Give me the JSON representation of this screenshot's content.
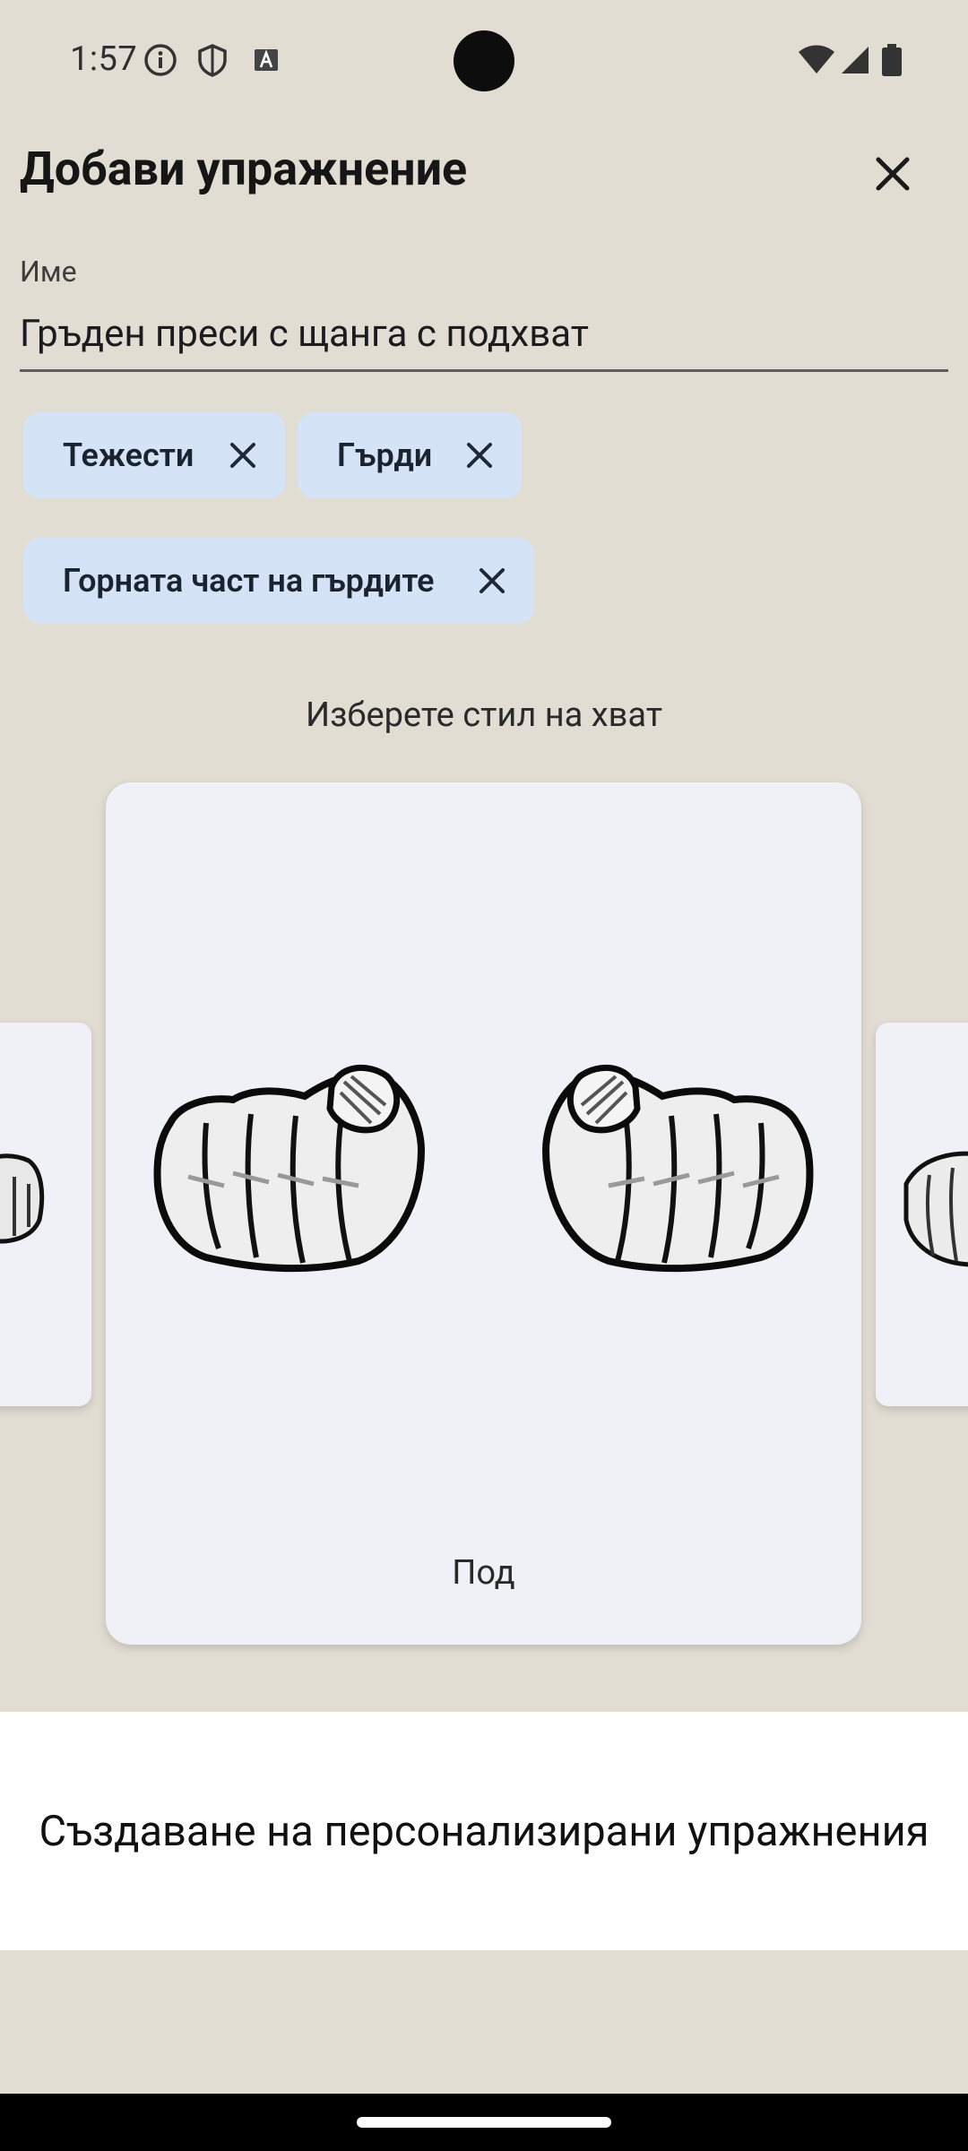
{
  "status_bar": {
    "time": "1:57",
    "left_icons": [
      "info-icon",
      "shield-icon",
      "text-a-icon"
    ],
    "right_icons": [
      "wifi-icon",
      "signal-icon",
      "battery-icon"
    ]
  },
  "header": {
    "title": "Добави упражнение",
    "close_icon": "close-icon"
  },
  "form": {
    "name_label": "Име",
    "name_value": "Гръден преси с щанга с подхват"
  },
  "chips": [
    {
      "label": "Тежести"
    },
    {
      "label": "Гърди"
    },
    {
      "label": "Горната част на гърдите"
    }
  ],
  "grip": {
    "prompt": "Изберете стил на хват",
    "selected_label": "Под"
  },
  "info_sheet": {
    "text": "Създаване на персонализирани упражнения"
  },
  "colors": {
    "background": "#e2ddd3",
    "chip": "#d5e3f6",
    "card": "#f0f1f7"
  }
}
